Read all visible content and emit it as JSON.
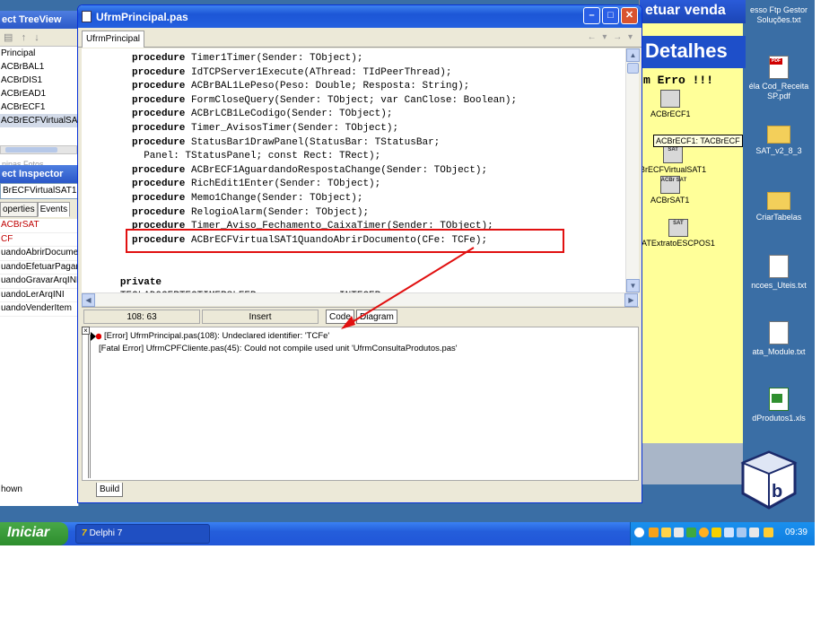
{
  "left_panels": {
    "treeview_title": "ect TreeView",
    "tree_items": [
      "Principal",
      "ACBrBAL1",
      "ACBrDIS1",
      "ACBrEAD1",
      "ACBrECF1",
      "ACBrECFVirtualSAT"
    ],
    "tree_cut": "ninas Fotos",
    "inspector_title": "ect Inspector",
    "inspector_object": "BrECFVirtualSAT1",
    "tab_properties": "operties",
    "tab_events": "Events",
    "inspector_rows": [
      "ACBrSAT",
      "CF",
      "uandoAbrirDocume",
      "uandoEfetuarPagar",
      "uandoGravarArqINI",
      "uandoLerArqINI",
      "uandoVenderItem"
    ],
    "inspector_footer": "hown"
  },
  "background_form": {
    "title": "etuar venda",
    "detalhes": "Detalhes",
    "erro": "m Erro !!!",
    "comp_ecf": "ACBrECF1",
    "hint": "ACBrECF1: TACBrECF",
    "comp_virtual": "BrECFVirtualSAT1",
    "comp_sat": "ACBrSAT1",
    "comp_extrato": "ATExtratoESCPOS1"
  },
  "desktop_icons": [
    "esso Ftp Gestor Soluções.txt",
    "éla Cod_Receita SP.pdf",
    "SAT_v2_8_3",
    "CriarTabelas",
    "ncoes_Uteis.txt",
    "ata_Module.txt",
    "dProdutos1.xls"
  ],
  "editor": {
    "window_title": "UfrmPrincipal.pas",
    "tab": "UfrmPrincipal",
    "code": [
      {
        "indent": 0,
        "kw": "procedure",
        "rest": " Timer1Timer(Sender: TObject);"
      },
      {
        "indent": 0,
        "kw": "procedure",
        "rest": " IdTCPServer1Execute(AThread: TIdPeerThread);"
      },
      {
        "indent": 0,
        "kw": "procedure",
        "rest": " ACBrBAL1LePeso(Peso: Double; Resposta: String);"
      },
      {
        "indent": 0,
        "kw": "procedure",
        "rest": " FormCloseQuery(Sender: TObject; var CanClose: Boolean);"
      },
      {
        "indent": 0,
        "kw": "procedure",
        "rest": " ACBrLCB1LeCodigo(Sender: TObject);"
      },
      {
        "indent": 0,
        "kw": "procedure",
        "rest": " Timer_AvisosTimer(Sender: TObject);"
      },
      {
        "indent": 0,
        "kw": "procedure",
        "rest": " StatusBar1DrawPanel(StatusBar: TStatusBar;"
      },
      {
        "indent": 2,
        "kw": "",
        "rest": "Panel: TStatusPanel; const Rect: TRect);"
      },
      {
        "indent": 0,
        "kw": "procedure",
        "rest": " ACBrECF1AguardandoRespostaChange(Sender: TObject);"
      },
      {
        "indent": 0,
        "kw": "procedure",
        "rest": " RichEdit1Enter(Sender: TObject);"
      },
      {
        "indent": 0,
        "kw": "procedure",
        "rest": " Memo1Change(Sender: TObject);"
      },
      {
        "indent": 0,
        "kw": "procedure",
        "rest": " RelogioAlarm(Sender: TObject);"
      },
      {
        "indent": 0,
        "kw": "procedure",
        "rest": " Timer_Aviso_Fechamento_CaixaTimer(Sender: TObject);"
      },
      {
        "indent": 0,
        "kw": "procedure",
        "rest": " ACBrECFVirtualSAT1QuandoAbrirDocumento(CFe: TCFe);"
      },
      {
        "indent": 0,
        "kw": "",
        "rest": ""
      },
      {
        "indent": 0,
        "kw": "",
        "rest": ""
      },
      {
        "indent": -2,
        "kw": "private",
        "rest": ""
      },
      {
        "indent": -2,
        "kw": "",
        "rest": "TECLADOCERTECTIMERSLEEP            : INTEGER;"
      }
    ],
    "cursor_pos": "108:  63",
    "mode": "Insert",
    "tab_code": "Code",
    "tab_diagram": "Diagram",
    "messages": [
      "[Error] UfrmPrincipal.pas(108): Undeclared identifier: 'TCFe'",
      "[Fatal Error] UfrmCPFCliente.pas(45): Could not compile used unit 'UfrmConsultaProdutos.pas'"
    ],
    "tab_build": "Build"
  },
  "taskbar": {
    "start": "Iniciar",
    "task_delphi": "Delphi 7",
    "clock": "09:39"
  },
  "colors": {
    "highlight": "#e11010",
    "title_bar": "#2460df",
    "form_yellow": "#ffff99"
  }
}
